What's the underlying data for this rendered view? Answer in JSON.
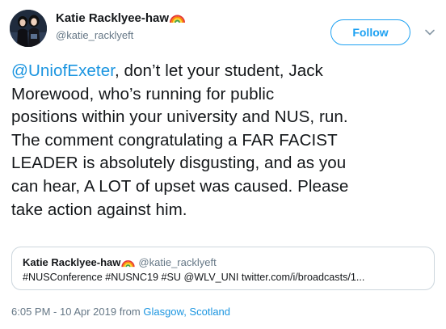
{
  "author": {
    "display_name": "Katie Racklyee-haw",
    "handle": "@katie_racklyeft",
    "name_emoji": "rainbow-icon",
    "avatar": "avatar-photo"
  },
  "actions": {
    "follow_label": "Follow",
    "menu_icon": "chevron-down-icon"
  },
  "tweet": {
    "mention": "@UniofExeter",
    "line1_rest": ", don’t let your student, Jack",
    "line2": "Morewood, who’s running for public",
    "line3": "positions within your university and NUS, run.",
    "line4": "The comment congratulating a FAR FACIST",
    "line5": "LEADER is absolutely disgusting, and as you",
    "line6": "can hear, A LOT of upset was caused. Please",
    "line7": "take action against him."
  },
  "quote": {
    "display_name": "Katie Racklyee-haw",
    "handle": "@katie_racklyeft",
    "text": "#NUSConference #NUSNC19 #SU @WLV_UNI  twitter.com/i/broadcasts/1..."
  },
  "meta": {
    "time": "6:05 PM - 10 Apr 2019",
    "from": "from",
    "location": "Glasgow, Scotland"
  },
  "colors": {
    "link": "#1b95e0",
    "follow": "#1da1f2",
    "secondary_text": "#657786",
    "border": "#ccd6dd"
  }
}
